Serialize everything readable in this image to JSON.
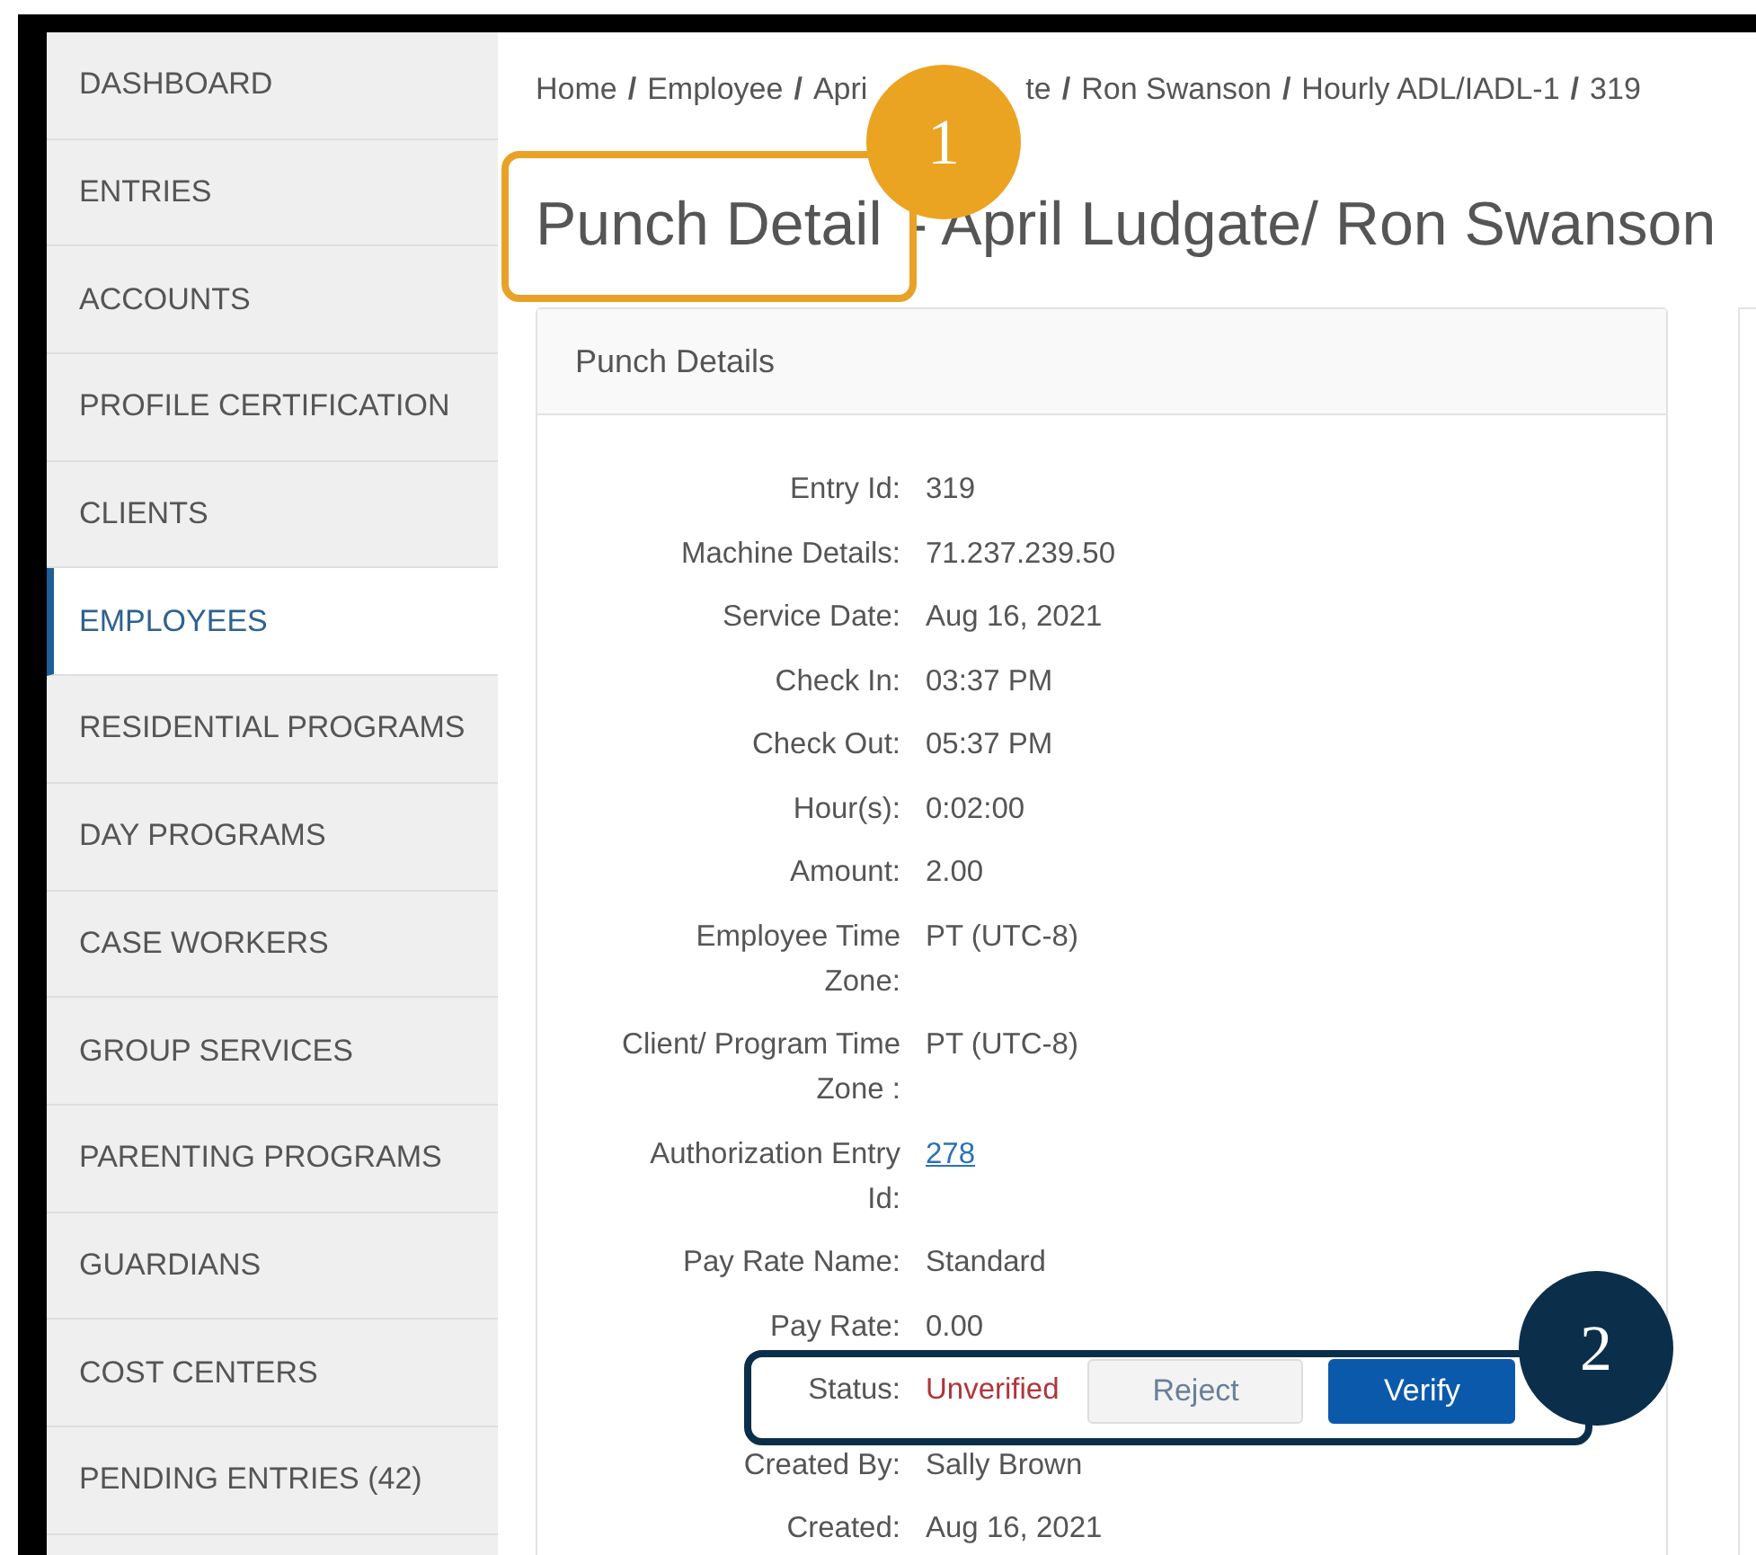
{
  "sidebar": {
    "items": [
      {
        "label": "DASHBOARD",
        "selected": false
      },
      {
        "label": "ENTRIES",
        "selected": false
      },
      {
        "label": "ACCOUNTS",
        "selected": false
      },
      {
        "label": "PROFILE CERTIFICATION",
        "selected": false
      },
      {
        "label": "CLIENTS",
        "selected": false
      },
      {
        "label": "EMPLOYEES",
        "selected": true
      },
      {
        "label": "RESIDENTIAL PROGRAMS",
        "selected": false
      },
      {
        "label": "DAY PROGRAMS",
        "selected": false
      },
      {
        "label": "CASE WORKERS",
        "selected": false
      },
      {
        "label": "GROUP SERVICES",
        "selected": false
      },
      {
        "label": "PARENTING PROGRAMS",
        "selected": false
      },
      {
        "label": "GUARDIANS",
        "selected": false
      },
      {
        "label": "COST CENTERS",
        "selected": false
      },
      {
        "label": "PENDING ENTRIES (42)",
        "selected": false
      }
    ]
  },
  "breadcrumb": [
    {
      "kind": "link",
      "text": "Home"
    },
    {
      "kind": "sep",
      "text": "/"
    },
    {
      "kind": "link",
      "text": "Employee"
    },
    {
      "kind": "sep",
      "text": "/"
    },
    {
      "kind": "link",
      "text": "Apri"
    },
    {
      "kind": "cut",
      "text": "te"
    },
    {
      "kind": "sep",
      "text": "/"
    },
    {
      "kind": "link",
      "text": "Ron Swanson"
    },
    {
      "kind": "sep",
      "text": "/"
    },
    {
      "kind": "link",
      "text": "Hourly ADL/IADL-1"
    },
    {
      "kind": "sep",
      "text": "/"
    },
    {
      "kind": "link",
      "text": "319"
    }
  ],
  "title": {
    "main": "Punch Detail",
    "rest": "- April Ludgate/ Ron Swanson"
  },
  "panel": {
    "title": "Punch Details",
    "fields": [
      {
        "kind": "text",
        "label": "Entry Id:",
        "value": "319"
      },
      {
        "kind": "text",
        "label": "Machine Details:",
        "value": "71.237.239.50"
      },
      {
        "kind": "text",
        "label": "Service Date:",
        "value": "Aug 16, 2021"
      },
      {
        "kind": "text",
        "label": "Check In:",
        "value": "03:37 PM"
      },
      {
        "kind": "text",
        "label": "Check Out:",
        "value": "05:37 PM"
      },
      {
        "kind": "text",
        "label": "Hour(s):",
        "value": "0:02:00"
      },
      {
        "kind": "text",
        "label": "Amount:",
        "value": "2.00"
      },
      {
        "kind": "text",
        "label": "Employee Time Zone:",
        "value": "PT (UTC-8)"
      },
      {
        "kind": "text",
        "label": "Client/ Program Time Zone :",
        "value": "PT (UTC-8)"
      },
      {
        "kind": "link",
        "label": "Authorization Entry Id:",
        "value": "278"
      },
      {
        "kind": "text",
        "label": "Pay Rate Name:",
        "value": "Standard"
      },
      {
        "kind": "text",
        "label": "Pay Rate:",
        "value": "0.00"
      },
      {
        "kind": "status",
        "label": "Status:",
        "value": "Unverified",
        "actions": [
          {
            "label": "Reject",
            "kind": "secondary"
          },
          {
            "label": "Verify",
            "kind": "primary"
          }
        ]
      },
      {
        "kind": "text",
        "label": "Created By:",
        "value": "Sally Brown"
      },
      {
        "kind": "text",
        "label": "Created:",
        "value": "Aug 16, 2021"
      }
    ]
  },
  "callouts": [
    {
      "number": "1"
    },
    {
      "number": "2"
    }
  ]
}
